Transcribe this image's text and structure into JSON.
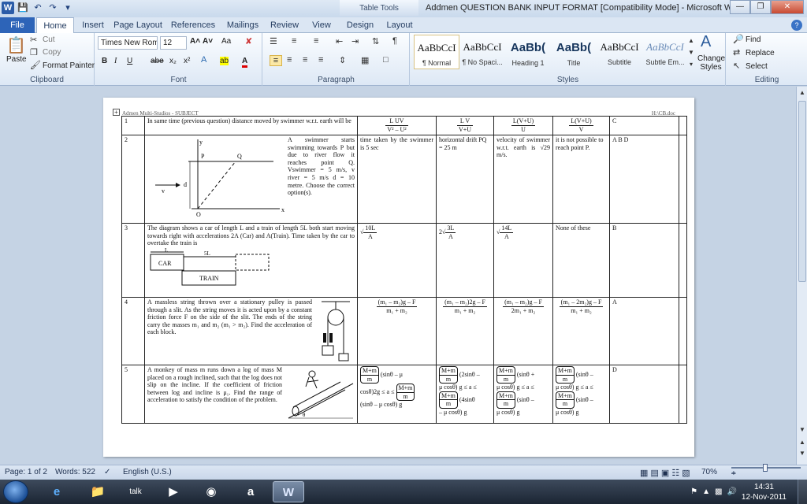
{
  "window": {
    "title": "Addmen QUESTION BANK INPUT FORMAT [Compatibility Mode]  -  Microsoft Word",
    "context_tab": "Table Tools"
  },
  "tabs": [
    "File",
    "Home",
    "Insert",
    "Page Layout",
    "References",
    "Mailings",
    "Review",
    "View",
    "Design",
    "Layout"
  ],
  "ribbon": {
    "clipboard": {
      "paste": "Paste",
      "cut": "Cut",
      "copy": "Copy",
      "format_painter": "Format Painter",
      "label": "Clipboard"
    },
    "font": {
      "name": "Times New Rom",
      "size": "12",
      "label": "Font",
      "bold": "B",
      "italic": "I",
      "underline": "U",
      "strike": "abe",
      "sub": "x₂",
      "sup": "x²",
      "grow": "A˄",
      "shrink": "A˅",
      "case": "Aa",
      "highlight": "ab",
      "color": "A"
    },
    "paragraph": {
      "label": "Paragraph"
    },
    "styles": {
      "label": "Styles",
      "items": [
        {
          "sample": "AaBbCcI",
          "name": "¶ Normal"
        },
        {
          "sample": "AaBbCcI",
          "name": "¶ No Spaci..."
        },
        {
          "sample": "AaBb(",
          "name": "Heading 1"
        },
        {
          "sample": "AaBb(",
          "name": "Title"
        },
        {
          "sample": "AaBbCcI",
          "name": "Subtitle"
        },
        {
          "sample": "AaBbCcI",
          "name": "Subtle Em..."
        }
      ],
      "change_styles": "Change Styles"
    },
    "editing": {
      "find": "Find",
      "replace": "Replace",
      "select": "Select",
      "label": "Editing"
    }
  },
  "document": {
    "header_left": "Admen Multi-Studios - SUBJECT",
    "header_right": "H:\\CB.doc",
    "rows": [
      {
        "num": "1",
        "question": "In same time (previous question) distance moved by swimmer w.r.t. earth will be",
        "opt1": {
          "num": "L UV",
          "den": "V² – U²"
        },
        "opt2": {
          "num": "L V",
          "den": "V+U"
        },
        "opt3": {
          "num": "L(V+U)",
          "den": "U"
        },
        "opt4": {
          "num": "L(V+U)",
          "den": "V"
        },
        "answer": "C"
      },
      {
        "num": "2",
        "question": "A swimmer starts swimming towards P but due to river flow it reaches point Q. Vswimmer = 5 m/s, v river = 5 m/s d = 10 metre. Choose the correct option(s).",
        "fig": {
          "y": "y",
          "x": "x",
          "p": "P",
          "q": "Q",
          "o": "O",
          "d": "d",
          "v": "v"
        },
        "opt1": "time taken by the swimmer is 5 sec",
        "opt2": "horizontal drift PQ = 25 m",
        "opt3": "velocity of swimmer w.r.t. earth is √29 m/s.",
        "opt4": "it is not possible to reach point P.",
        "answer": "A B D"
      },
      {
        "num": "3",
        "question": "The diagram shows a car of length L and a train of length 5L both start moving towards right with accelerations 2A (Car) and A(Train). Time taken by the car to overtake the train is",
        "fig": {
          "car": "CAR",
          "train": "TRAIN",
          "l": "L",
          "l5": "5L"
        },
        "opt1": {
          "num": "10L",
          "den": "A"
        },
        "opt2": {
          "pre": "2",
          "num": "3L",
          "den": "A"
        },
        "opt3": {
          "num": "14L",
          "den": "A"
        },
        "opt4": "None of these",
        "answer": "B"
      },
      {
        "num": "4",
        "question": "A massless string thrown over a stationary pulley is passed through a slit. As the string moves it is acted upon by a constant friction force F on the side of the slit. The ends of the string carry the masses m₁ and m₂ (m₁ > m₂). Find the acceleration of each block.",
        "opt1": {
          "num": "(m₁ – m₂)g – F",
          "den": "m₁ + m₂"
        },
        "opt2": {
          "num": "(m₁ – m₂)2g – F",
          "den": "m₁ + m₂"
        },
        "opt3": {
          "num": "(m₁ – m₂)g – F",
          "den": "2m₁ + m₂"
        },
        "opt4": {
          "num": "(m₁ – 2m₂)g – F",
          "den": "m₁ + m₂"
        },
        "answer": "A"
      },
      {
        "num": "5",
        "question": "A monkey of mass m runs down a log of mass M placed on a rough inclined, such that the log does not slip on the incline. If the coefficient of friction between log and incline is μ₁. Find the range of acceleration to satisfy the condition of the problem.",
        "fig": {
          "theta": "θ"
        },
        "frac": {
          "num": "M+m",
          "den": "m"
        },
        "opt1": [
          "(sinθ – μ",
          "cosθ)2g ≤ a ≤",
          "(sinθ – μ cosθ) g"
        ],
        "opt2": [
          "(2sinθ –",
          "μ cosθ) g ≤ a ≤",
          "(4sinθ",
          "– μ cosθ) g"
        ],
        "opt3": [
          "(sinθ +",
          "μ cosθ) g ≤ a ≤",
          "(sinθ –",
          "μ cosθ) g"
        ],
        "opt4": [
          "(sinθ –",
          "μ cosθ) g ≤ a ≤",
          "(sinθ –",
          "μ cosθ) g"
        ],
        "answer": "D"
      }
    ]
  },
  "status": {
    "page": "Page: 1 of 2",
    "words": "Words: 522",
    "language": "English (U.S.)",
    "zoom": "70%"
  },
  "taskbar": {
    "apps": [
      "ie-icon",
      "explorer-icon",
      "talk-icon",
      "media-icon",
      "chrome-icon",
      "a-icon",
      "word-icon"
    ],
    "time": "14:31",
    "date": "12-Nov-2011"
  }
}
